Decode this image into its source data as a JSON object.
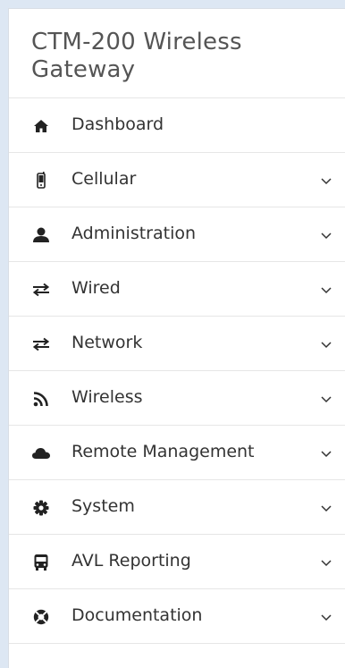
{
  "brand": {
    "line1": "CTM-200 Wireless",
    "line2": "Gateway"
  },
  "nav": {
    "items": [
      {
        "label": "Dashboard",
        "icon": "home-icon",
        "expandable": false
      },
      {
        "label": "Cellular",
        "icon": "mobile-phone-icon",
        "expandable": true
      },
      {
        "label": "Administration",
        "icon": "user-icon",
        "expandable": true
      },
      {
        "label": "Wired",
        "icon": "exchange-arrows-icon",
        "expandable": true
      },
      {
        "label": "Network",
        "icon": "exchange-arrows-icon",
        "expandable": true
      },
      {
        "label": "Wireless",
        "icon": "wifi-signal-icon",
        "expandable": true
      },
      {
        "label": "Remote Management",
        "icon": "cloud-icon",
        "expandable": true
      },
      {
        "label": "System",
        "icon": "gear-icon",
        "expandable": true
      },
      {
        "label": "AVL Reporting",
        "icon": "bus-icon",
        "expandable": true
      },
      {
        "label": "Documentation",
        "icon": "life-ring-icon",
        "expandable": true
      }
    ]
  },
  "colors": {
    "text": "#333333",
    "brand_text": "#555555",
    "divider": "#e6e6e6",
    "icon": "#222222",
    "outer_background": "#dde7f3"
  }
}
